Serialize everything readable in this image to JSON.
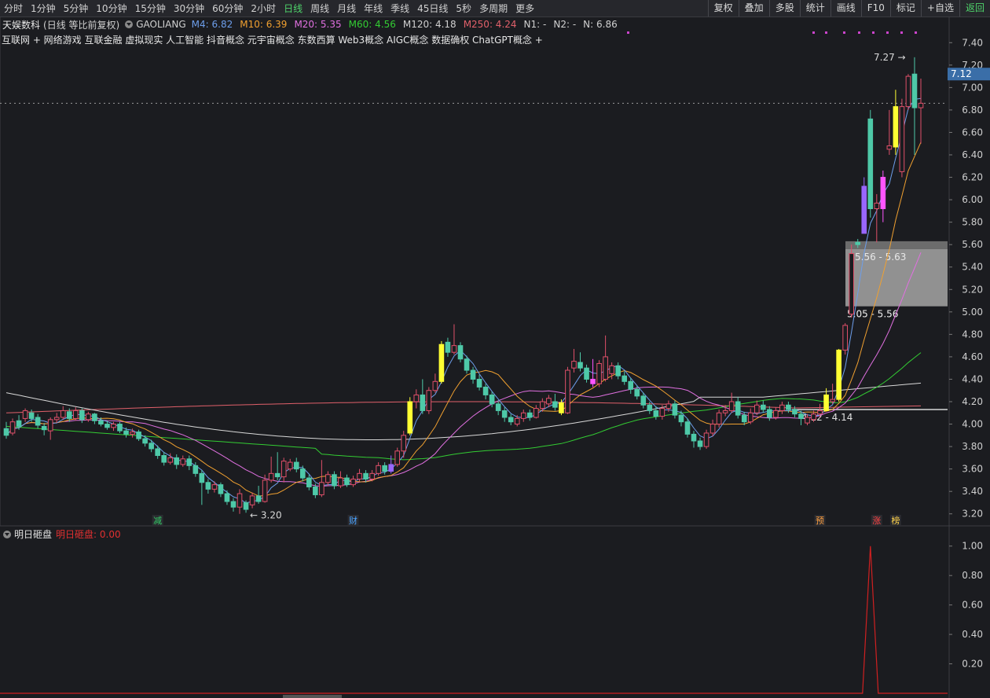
{
  "toolbar": {
    "periods": [
      "分时",
      "1分钟",
      "5分钟",
      "10分钟",
      "15分钟",
      "30分钟",
      "60分钟",
      "2小时",
      "日线",
      "周线",
      "月线",
      "年线",
      "季线",
      "45日线",
      "5秒",
      "多周期",
      "更多"
    ],
    "active_period": "日线",
    "right_buttons": [
      "复权",
      "叠加",
      "多股",
      "统计",
      "画线",
      "F10",
      "标记",
      "+自选",
      "返回"
    ]
  },
  "info": {
    "stock_name": "天娱数科",
    "mode": "(日线 等比前复权)",
    "indicator_name": "GAOLIANG",
    "ma": [
      {
        "label": "M4: 6.82",
        "color": "#6d9eeb"
      },
      {
        "label": "M10: 6.39",
        "color": "#f0a030"
      },
      {
        "label": "M20: 5.35",
        "color": "#e070e0"
      },
      {
        "label": "M60: 4.56",
        "color": "#33cc33"
      },
      {
        "label": "M120: 4.18",
        "color": "#d0d0d0"
      },
      {
        "label": "M250: 4.24",
        "color": "#e0606a"
      },
      {
        "label": "N1: -",
        "color": "#d0d0d0"
      },
      {
        "label": "N2: -",
        "color": "#d0d0d0"
      },
      {
        "label": "N: 6.86",
        "color": "#d0d0d0"
      }
    ],
    "concepts": "互联网 + 网络游戏 互联金融 虚拟现实 人工智能 抖音概念 元宇宙概念 东数西算 Web3概念 AIGC概念 数据确权 ChatGPT概念 +"
  },
  "sub_panel": {
    "name": "明日砸盘",
    "value_label": "明日砸盘: 0.00"
  },
  "chart_data": {
    "type": "candlestick",
    "price_axis": {
      "ticks": [
        "7.40",
        "7.20",
        "7.00",
        "6.80",
        "6.60",
        "6.40",
        "6.20",
        "6.00",
        "5.80",
        "5.60",
        "5.40",
        "5.20",
        "5.00",
        "4.80",
        "4.60",
        "4.40",
        "4.20",
        "4.00",
        "3.80",
        "3.60",
        "3.40",
        "3.20"
      ],
      "range": [
        3.1,
        7.5
      ],
      "current_price": "7.12",
      "dotted_level": 6.86
    },
    "annotations": {
      "high_label": "7.27",
      "low_label": "3.20",
      "zone_upper_label": "5.56 - 5.63",
      "zone_lower_label": "5.05 - 5.56",
      "gap_label": "4.12 - 4.14",
      "zone_upper": [
        5.56,
        5.63
      ],
      "zone_lower": [
        5.05,
        5.56
      ],
      "gap_level": 4.13
    },
    "markers": [
      {
        "text": "减",
        "color": "#33cc66",
        "index": 24
      },
      {
        "text": "财",
        "color": "#4aa3ff",
        "index": 55
      },
      {
        "text": "预",
        "color": "#ff9f40",
        "index": 129
      },
      {
        "text": "涨",
        "color": "#ff4444",
        "index": 138
      },
      {
        "text": "榜",
        "color": "#ffd24a",
        "index": 141
      }
    ],
    "candles": [
      [
        3.96,
        3.9,
        4.02,
        3.87
      ],
      [
        3.92,
        4.02,
        4.05,
        3.9
      ],
      [
        4.03,
        3.98,
        4.08,
        3.95
      ],
      [
        4.05,
        4.12,
        4.14,
        4.02
      ],
      [
        4.1,
        4.05,
        4.13,
        4.02
      ],
      [
        4.06,
        3.99,
        4.09,
        3.96
      ],
      [
        3.98,
        3.95,
        4.01,
        3.9
      ],
      [
        3.94,
        4.04,
        4.06,
        3.86
      ],
      [
        4.04,
        4.06,
        4.1,
        4.01
      ],
      [
        4.06,
        4.12,
        4.16,
        4.04
      ],
      [
        4.11,
        4.05,
        4.14,
        4.02
      ],
      [
        4.05,
        4.12,
        4.15,
        4.03
      ],
      [
        4.12,
        4.04,
        4.14,
        4.01
      ],
      [
        4.04,
        4.09,
        4.11,
        4.02
      ],
      [
        4.09,
        4.03,
        4.1,
        4.0
      ],
      [
        4.03,
        4.0,
        4.06,
        3.98
      ],
      [
        4.0,
        3.97,
        4.03,
        3.95
      ],
      [
        3.97,
        4.0,
        4.02,
        3.94
      ],
      [
        4.0,
        3.94,
        4.02,
        3.92
      ],
      [
        3.94,
        3.91,
        3.97,
        3.88
      ],
      [
        3.91,
        3.93,
        3.96,
        3.88
      ],
      [
        3.93,
        3.87,
        3.95,
        3.85
      ],
      [
        3.87,
        3.83,
        3.9,
        3.8
      ],
      [
        3.83,
        3.78,
        3.86,
        3.75
      ],
      [
        3.78,
        3.72,
        3.81,
        3.69
      ],
      [
        3.72,
        3.66,
        3.75,
        3.63
      ],
      [
        3.66,
        3.7,
        3.74,
        3.64
      ],
      [
        3.7,
        3.64,
        3.73,
        3.6
      ],
      [
        3.64,
        3.69,
        3.72,
        3.62
      ],
      [
        3.69,
        3.63,
        3.72,
        3.59
      ],
      [
        3.63,
        3.56,
        3.66,
        3.53
      ],
      [
        3.56,
        3.48,
        3.59,
        3.28
      ],
      [
        3.48,
        3.42,
        3.51,
        3.38
      ],
      [
        3.42,
        3.46,
        3.49,
        3.39
      ],
      [
        3.46,
        3.38,
        3.48,
        3.35
      ],
      [
        3.38,
        3.31,
        3.41,
        3.28
      ],
      [
        3.31,
        3.26,
        3.34,
        3.22
      ],
      [
        3.26,
        3.38,
        3.42,
        3.2
      ],
      [
        3.3,
        3.24,
        3.32,
        3.21
      ],
      [
        3.28,
        3.36,
        3.39,
        3.25
      ],
      [
        3.36,
        3.31,
        3.45,
        3.29
      ],
      [
        3.31,
        3.5,
        3.55,
        3.3
      ],
      [
        3.5,
        3.56,
        3.71,
        3.48
      ],
      [
        3.56,
        3.53,
        3.75,
        3.5
      ],
      [
        3.53,
        3.67,
        3.7,
        3.48
      ],
      [
        3.6,
        3.66,
        3.69,
        3.58
      ],
      [
        3.66,
        3.6,
        3.7,
        3.57
      ],
      [
        3.6,
        3.52,
        3.63,
        3.49
      ],
      [
        3.52,
        3.44,
        3.55,
        3.41
      ],
      [
        3.44,
        3.37,
        3.47,
        3.34
      ],
      [
        3.37,
        3.48,
        3.68,
        3.35
      ],
      [
        3.48,
        3.55,
        3.58,
        3.45
      ],
      [
        3.55,
        3.45,
        3.58,
        3.42
      ],
      [
        3.45,
        3.52,
        3.58,
        3.43
      ],
      [
        3.52,
        3.46,
        3.55,
        3.44
      ],
      [
        3.46,
        3.51,
        3.54,
        3.44
      ],
      [
        3.51,
        3.56,
        3.6,
        3.49
      ],
      [
        3.56,
        3.51,
        3.59,
        3.48
      ],
      [
        3.51,
        3.56,
        3.59,
        3.49
      ],
      [
        3.56,
        3.63,
        3.66,
        3.54
      ],
      [
        3.63,
        3.58,
        3.66,
        3.55
      ],
      [
        3.58,
        3.64,
        3.72,
        3.56
      ],
      [
        3.64,
        3.76,
        3.79,
        3.62
      ],
      [
        3.76,
        3.9,
        3.94,
        3.7
      ],
      [
        3.92,
        4.2,
        4.24,
        3.9
      ],
      [
        4.2,
        4.26,
        4.31,
        4.14
      ],
      [
        4.26,
        4.12,
        4.4,
        4.09
      ],
      [
        4.12,
        4.3,
        4.33,
        4.09
      ],
      [
        4.3,
        4.38,
        4.45,
        4.28
      ],
      [
        4.38,
        4.71,
        4.74,
        4.36
      ],
      [
        4.73,
        4.64,
        4.77,
        4.6
      ],
      [
        4.64,
        4.7,
        4.89,
        4.62
      ],
      [
        4.7,
        4.58,
        4.73,
        4.55
      ],
      [
        4.58,
        4.48,
        4.61,
        4.45
      ],
      [
        4.48,
        4.4,
        4.51,
        4.36
      ],
      [
        4.4,
        4.33,
        4.44,
        4.3
      ],
      [
        4.33,
        4.26,
        4.36,
        4.22
      ],
      [
        4.26,
        4.18,
        4.29,
        4.15
      ],
      [
        4.18,
        4.12,
        4.21,
        4.08
      ],
      [
        4.12,
        4.06,
        4.15,
        4.02
      ],
      [
        4.06,
        4.02,
        4.09,
        3.99
      ],
      [
        4.0,
        4.05,
        4.08,
        3.98
      ],
      [
        4.05,
        4.1,
        4.13,
        4.02
      ],
      [
        4.1,
        4.06,
        4.13,
        4.03
      ],
      [
        4.06,
        4.14,
        4.17,
        4.05
      ],
      [
        4.14,
        4.2,
        4.23,
        4.11
      ],
      [
        4.18,
        4.23,
        4.26,
        4.15
      ],
      [
        4.2,
        4.15,
        4.27,
        4.12
      ],
      [
        4.1,
        4.19,
        4.22,
        4.08
      ],
      [
        4.1,
        4.48,
        4.51,
        4.09
      ],
      [
        4.5,
        4.56,
        4.67,
        4.46
      ],
      [
        4.55,
        4.5,
        4.64,
        4.47
      ],
      [
        4.5,
        4.4,
        4.53,
        4.37
      ],
      [
        4.4,
        4.36,
        4.58,
        4.33
      ],
      [
        4.36,
        4.54,
        4.57,
        4.33
      ],
      [
        4.4,
        4.6,
        4.79,
        4.38
      ],
      [
        4.45,
        4.52,
        4.55,
        4.4
      ],
      [
        4.52,
        4.43,
        4.55,
        4.4
      ],
      [
        4.43,
        4.38,
        4.47,
        4.35
      ],
      [
        4.38,
        4.31,
        4.41,
        4.27
      ],
      [
        4.31,
        4.25,
        4.34,
        4.22
      ],
      [
        4.25,
        4.17,
        4.28,
        4.14
      ],
      [
        4.17,
        4.12,
        4.2,
        4.09
      ],
      [
        4.12,
        4.07,
        4.16,
        4.04
      ],
      [
        4.07,
        4.14,
        4.17,
        4.04
      ],
      [
        4.14,
        4.18,
        4.21,
        4.11
      ],
      [
        4.18,
        4.08,
        4.21,
        4.05
      ],
      [
        4.08,
        4.02,
        4.12,
        3.98
      ],
      [
        4.02,
        3.91,
        4.05,
        3.88
      ],
      [
        3.91,
        3.85,
        3.94,
        3.79
      ],
      [
        3.85,
        3.8,
        3.88,
        3.77
      ],
      [
        3.8,
        3.92,
        3.95,
        3.78
      ],
      [
        3.92,
        4.0,
        4.04,
        3.89
      ],
      [
        4.0,
        4.1,
        4.13,
        3.97
      ],
      [
        4.1,
        4.12,
        4.17,
        4.07
      ],
      [
        4.12,
        4.2,
        4.28,
        4.1
      ],
      [
        4.2,
        4.08,
        4.24,
        4.05
      ],
      [
        4.08,
        4.02,
        4.11,
        3.99
      ],
      [
        4.02,
        4.1,
        4.14,
        4.0
      ],
      [
        4.1,
        4.17,
        4.21,
        4.08
      ],
      [
        4.17,
        4.13,
        4.21,
        4.1
      ],
      [
        4.13,
        4.06,
        4.16,
        4.03
      ],
      [
        4.06,
        4.12,
        4.15,
        4.04
      ],
      [
        4.12,
        4.17,
        4.2,
        4.09
      ],
      [
        4.17,
        4.13,
        4.2,
        4.1
      ],
      [
        4.13,
        4.09,
        4.16,
        4.06
      ],
      [
        4.09,
        4.05,
        4.12,
        3.99
      ],
      [
        4.01,
        4.06,
        4.09,
        3.99
      ],
      [
        4.04,
        4.09,
        4.12,
        4.02
      ],
      [
        4.09,
        4.12,
        4.18,
        4.06
      ],
      [
        4.12,
        4.26,
        4.32,
        4.12
      ],
      [
        4.2,
        4.22,
        4.36,
        4.18
      ],
      [
        4.22,
        4.66,
        4.67,
        4.2
      ],
      [
        4.66,
        4.88,
        4.9,
        4.62
      ],
      [
        4.98,
        5.52,
        5.6,
        4.95
      ],
      [
        5.62,
        5.6,
        5.65,
        5.57
      ],
      [
        5.7,
        6.12,
        6.2,
        5.88
      ],
      [
        6.72,
        5.92,
        6.8,
        5.84
      ],
      [
        5.92,
        5.97,
        6.05,
        5.62
      ],
      [
        5.92,
        6.2,
        6.26,
        5.8
      ],
      [
        6.45,
        6.48,
        6.8,
        6.4
      ],
      [
        6.47,
        6.83,
        6.98,
        6.4
      ],
      [
        6.25,
        6.83,
        6.9,
        6.2
      ],
      [
        6.83,
        7.1,
        7.12,
        6.8
      ],
      [
        7.12,
        6.82,
        7.27,
        6.4
      ],
      [
        6.82,
        6.86,
        7.08,
        6.5
      ]
    ],
    "strong_bars": {
      "64": "#ffff33",
      "69": "#ffff33",
      "88": "#ffff33",
      "93": "#ff55ff",
      "61": "#9966ff",
      "130": "#ffff33",
      "132": "#ffff33",
      "136": "#9966ff",
      "139": "#ff55ff",
      "141": "#ffff33"
    },
    "sub_axis": {
      "ticks": [
        "1.00",
        "0.80",
        "0.60",
        "0.40",
        "0.20"
      ],
      "range": [
        0,
        1.1
      ]
    },
    "sub_series": {
      "name": "明日砸盘",
      "spike_index": 137,
      "spike_value": 1.0
    }
  }
}
